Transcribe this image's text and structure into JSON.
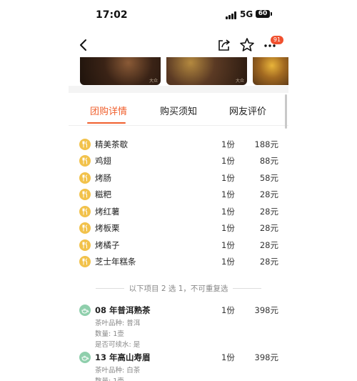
{
  "status_bar": {
    "time": "17:02",
    "network": "5G",
    "battery": "60"
  },
  "nav": {
    "badge_count": "91"
  },
  "tabs": [
    {
      "label": "团购详情",
      "active": true
    },
    {
      "label": "购买须知",
      "active": false
    },
    {
      "label": "网友评价",
      "active": false
    }
  ],
  "items": [
    {
      "name": "精美茶歇",
      "qty": "1份",
      "price": "188元"
    },
    {
      "name": "鸡翅",
      "qty": "1份",
      "price": "88元"
    },
    {
      "name": "烤肠",
      "qty": "1份",
      "price": "58元"
    },
    {
      "name": "糍粑",
      "qty": "1份",
      "price": "28元"
    },
    {
      "name": "烤红薯",
      "qty": "1份",
      "price": "28元"
    },
    {
      "name": "烤板栗",
      "qty": "1份",
      "price": "28元"
    },
    {
      "name": "烤橘子",
      "qty": "1份",
      "price": "28元"
    },
    {
      "name": "芝士年糕条",
      "qty": "1份",
      "price": "28元"
    }
  ],
  "choice_note": "以下项目 2 选 1，不可重复选",
  "tea_options": [
    {
      "name": "08 年普洱熟茶",
      "qty": "1份",
      "price": "398元",
      "details": [
        "茶叶品种: 普洱",
        "数量: 1壶",
        "是否可续水: 是"
      ]
    },
    {
      "name": "13 年高山寿眉",
      "qty": "1份",
      "price": "398元",
      "details": [
        "茶叶品种: 白茶",
        "数量: 1壶"
      ]
    }
  ],
  "photo_watermark": "大众"
}
